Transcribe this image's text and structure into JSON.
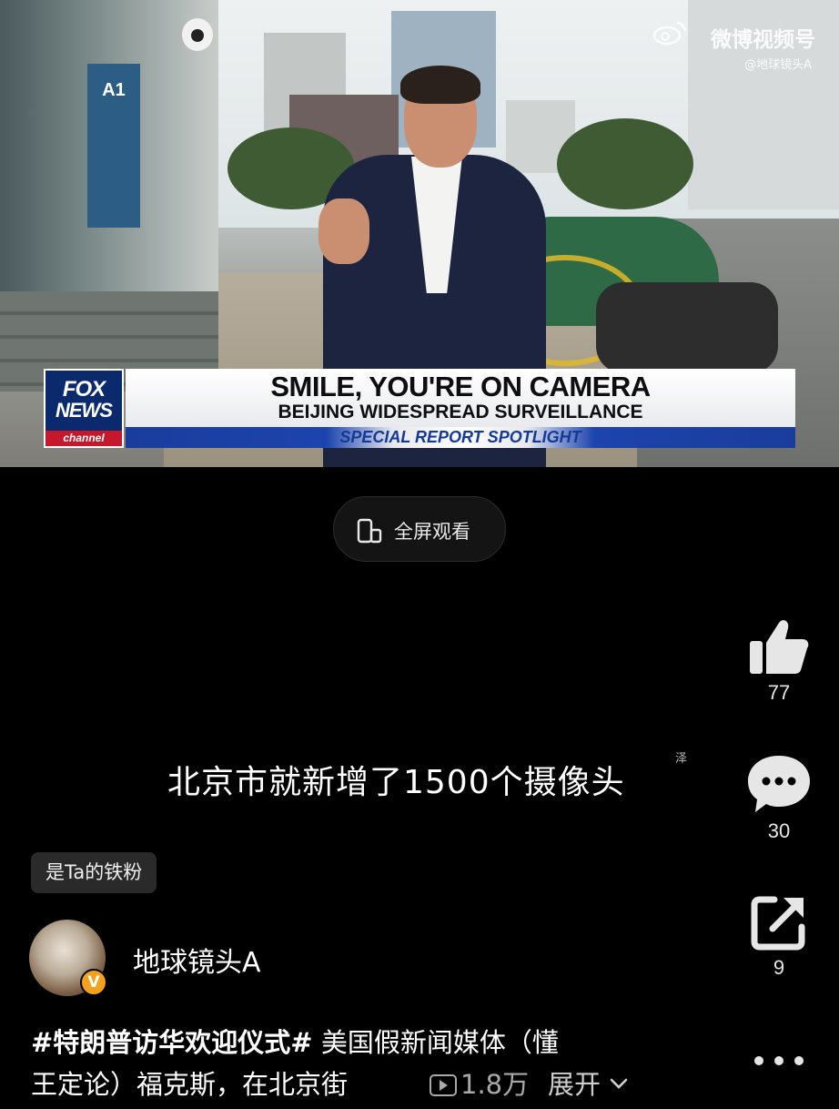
{
  "video": {
    "watermark_title": "微博视频号",
    "watermark_handle": "@地球镜头A",
    "station_sign": "A1",
    "network_top": "FOX",
    "network_bottom": "NEWS",
    "network_channel": "channel",
    "headline": "SMILE, YOU'RE ON CAMERA",
    "subheadline": "BEIJING WIDESPREAD SURVEILLANCE",
    "segment": "SPECIAL REPORT SPOTLIGHT"
  },
  "fullscreen": {
    "label": "全屏观看",
    "icon": "fullscreen-phone-icon"
  },
  "subtitle": {
    "text": "北京市就新增了1500个摄像头",
    "mark": "泽"
  },
  "actions": {
    "like": {
      "icon": "thumbs-up-icon",
      "count": "77"
    },
    "comment": {
      "icon": "comment-bubble-icon",
      "count": "30"
    },
    "share": {
      "icon": "share-icon",
      "count": "9"
    },
    "more": {
      "icon": "more-dots-icon"
    }
  },
  "fan_badge": "是Ta的铁粉",
  "author": {
    "name": "地球镜头A",
    "verified_icon": "verified-v-icon"
  },
  "description": {
    "hashtag": "#特朗普访华欢迎仪式#",
    "line1_rest": " 美国假新闻媒体（懂",
    "line2": "王定论）福克斯，在北京街",
    "views": "1.8万",
    "expand": "展开"
  },
  "colors": {
    "background": "#000000",
    "fox_blue": "#0b2a6e",
    "fox_red": "#c5182c",
    "badge_bg": "#2a2a2a",
    "verified": "#f2a21c"
  }
}
